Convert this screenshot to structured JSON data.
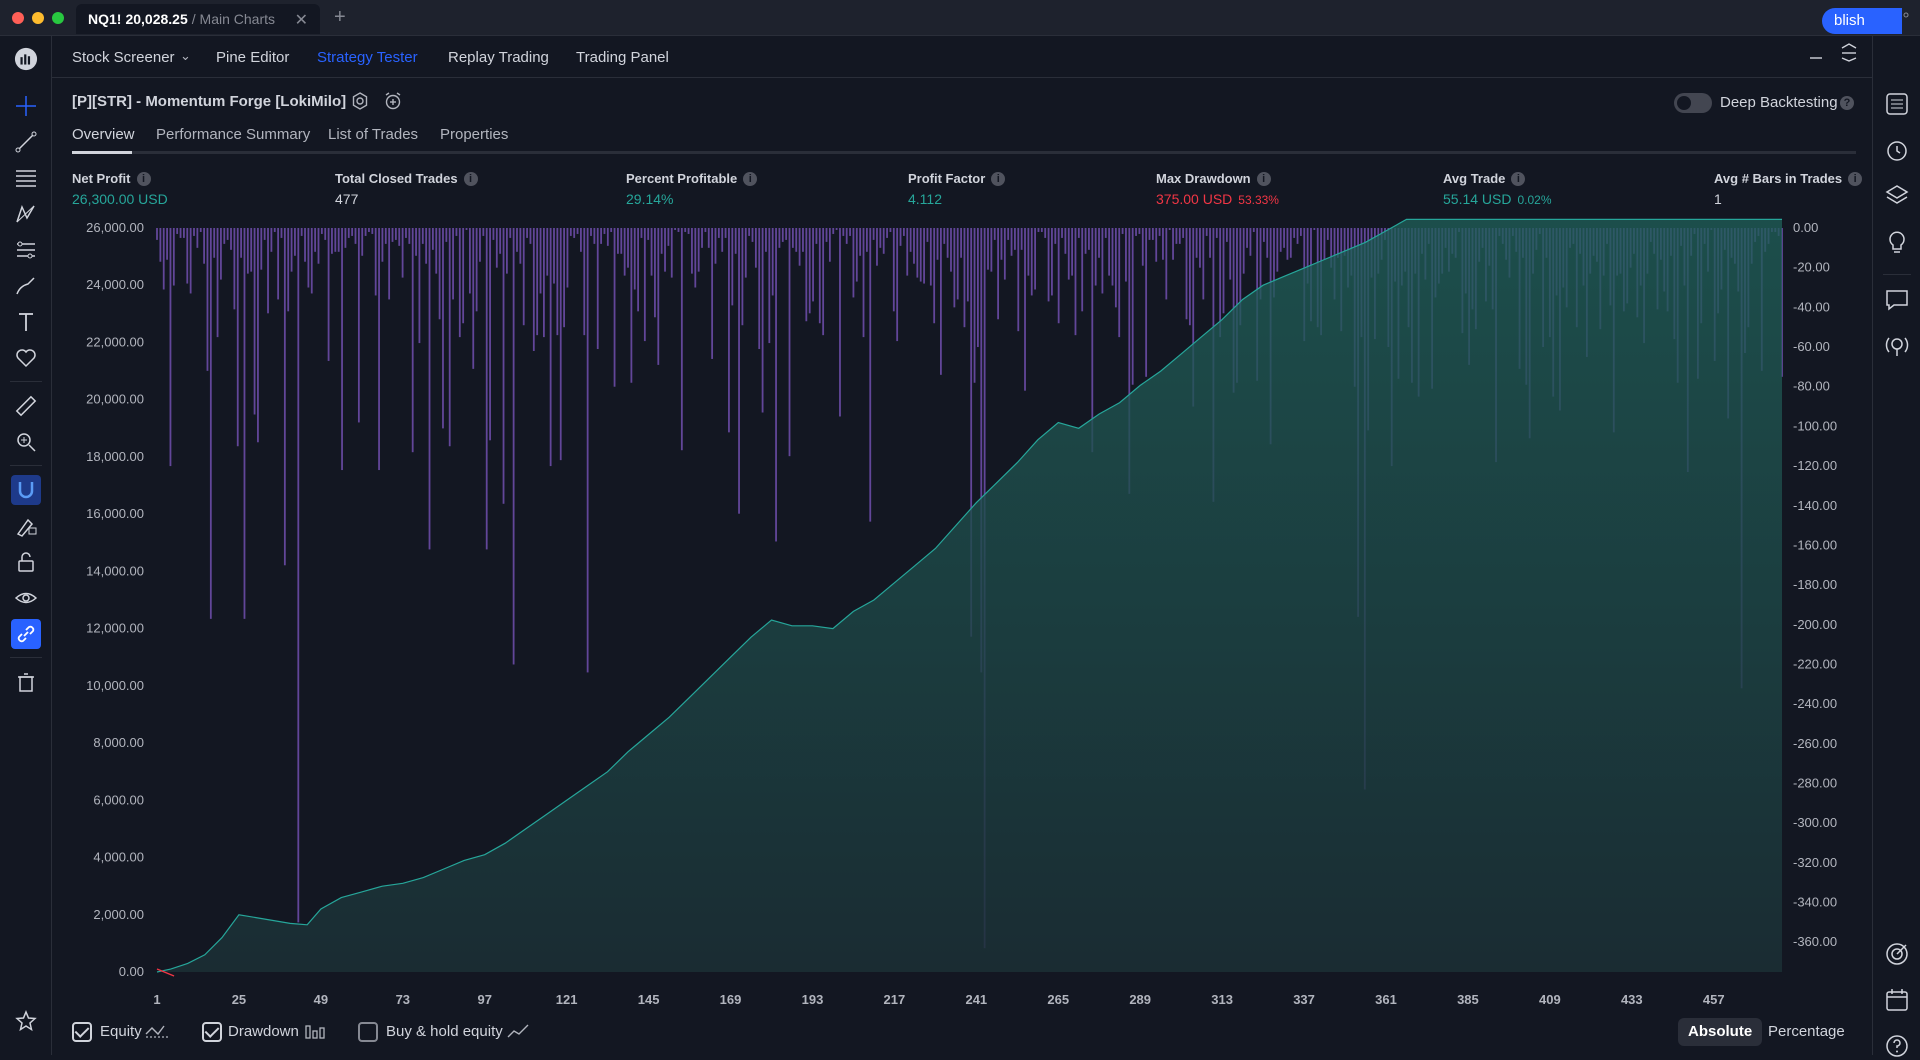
{
  "window": {
    "tab_symbol": "NQ1!",
    "tab_price": "20,028.25",
    "tab_subtitle": "/ Main Charts",
    "tab_close": "✕",
    "new_tab": "+"
  },
  "menu": {
    "items": [
      {
        "label": "Stock Screener",
        "dropdown": true
      },
      {
        "label": "Pine Editor"
      },
      {
        "label": "Strategy Tester",
        "active": true
      },
      {
        "label": "Replay Trading"
      },
      {
        "label": "Trading Panel"
      }
    ],
    "publish_label": "blish"
  },
  "strategy": {
    "title": "[P][STR] - Momentum Forge [LokiMilo]",
    "deep_backtesting_label": "Deep Backtesting",
    "deep_backtesting_on": false
  },
  "subtabs": [
    "Overview",
    "Performance Summary",
    "List of Trades",
    "Properties"
  ],
  "metrics": [
    {
      "label": "Net Profit",
      "value": "26,300.00 USD",
      "pct": "",
      "color": "#26a69a"
    },
    {
      "label": "Total Closed Trades",
      "value": "477",
      "pct": "",
      "color": "#d1d4dc"
    },
    {
      "label": "Percent Profitable",
      "value": "29.14%",
      "pct": "",
      "color": "#26a69a"
    },
    {
      "label": "Profit Factor",
      "value": "4.112",
      "pct": "",
      "color": "#26a69a"
    },
    {
      "label": "Max Drawdown",
      "value": "375.00 USD",
      "pct": "53.33%",
      "color": "#f23645"
    },
    {
      "label": "Avg Trade",
      "value": "55.14 USD",
      "pct": "0.02%",
      "color": "#26a69a"
    },
    {
      "label": "Avg # Bars in Trades",
      "value": "1",
      "pct": "",
      "color": "#d1d4dc"
    }
  ],
  "chart_data": {
    "type": "area",
    "series": [
      {
        "name": "Equity",
        "color": "#26a69a",
        "x": [
          1,
          5,
          10,
          15,
          20,
          25,
          30,
          35,
          40,
          45,
          49,
          55,
          61,
          67,
          73,
          79,
          85,
          91,
          97,
          103,
          109,
          115,
          121,
          127,
          133,
          139,
          145,
          151,
          157,
          163,
          169,
          175,
          181,
          187,
          193,
          199,
          205,
          211,
          217,
          223,
          229,
          235,
          241,
          247,
          253,
          259,
          265,
          271,
          277,
          283,
          289,
          295,
          301,
          307,
          313,
          319,
          325,
          331,
          337,
          343,
          349,
          355,
          361,
          367,
          373,
          379,
          385,
          391,
          397,
          403,
          409,
          415,
          421,
          427,
          433,
          439,
          445,
          451,
          457,
          463,
          469,
          477
        ],
        "y": [
          0,
          100,
          300,
          600,
          1200,
          2000,
          1900,
          1800,
          1700,
          1650,
          2200,
          2600,
          2800,
          3000,
          3100,
          3300,
          3600,
          3900,
          4100,
          4500,
          5000,
          5500,
          6000,
          6500,
          7000,
          7700,
          8300,
          8900,
          9600,
          10300,
          11000,
          11700,
          12300,
          12100,
          12100,
          12000,
          12600,
          13000,
          13600,
          14200,
          14800,
          15600,
          16400,
          17100,
          17800,
          18600,
          19200,
          19000,
          19500,
          19900,
          20500,
          21000,
          21600,
          22200,
          22800,
          23500,
          24000,
          24300,
          24600,
          24900,
          25200,
          25500,
          25900,
          26300,
          26300,
          26300,
          26300,
          26300,
          26300,
          26300,
          26300,
          26300,
          26300,
          26300,
          26300,
          26300,
          26300,
          26300,
          26300,
          26300,
          26300,
          26300
        ]
      },
      {
        "name": "Drawdown",
        "color": "#7e57c2",
        "y": [
          -6,
          -17,
          -31,
          -16,
          -120,
          -29,
          -3,
          -5,
          -5,
          -28,
          -33,
          -4,
          -10,
          -2,
          -18,
          -72,
          -197,
          -15,
          -55,
          -26,
          -8,
          -6,
          -11,
          -41,
          -110,
          -15,
          -197,
          -23,
          -22,
          -94,
          -108,
          -21,
          -6,
          -43,
          -12,
          -2,
          -36,
          -5,
          -170,
          -42,
          -22,
          -14,
          -350,
          -4,
          -17,
          -30,
          -33,
          -12,
          -18,
          -3,
          -6,
          -67,
          -13,
          -12,
          -12,
          -122,
          -10,
          -5,
          -4,
          -8,
          -98,
          -14,
          -4,
          -2,
          -3,
          -34,
          -122,
          -17,
          -8,
          -36,
          -7,
          -6,
          -9,
          -25,
          -5,
          -8,
          -113,
          -14,
          -58,
          -8,
          -18,
          -162,
          -11,
          -23,
          -46,
          -101,
          -7,
          -110,
          -36,
          -4,
          -55,
          -48,
          -1,
          -33,
          -71,
          -42,
          -17,
          -4,
          -162,
          -107,
          -6,
          -20,
          -13,
          -139,
          -23,
          -5,
          -220,
          -12,
          -18,
          -49,
          -5,
          -8,
          -62,
          -54,
          -33,
          -55,
          -24,
          -120,
          -28,
          -54,
          -117,
          -50,
          -30,
          -4,
          -5,
          -3,
          -12,
          -54,
          -224,
          -4,
          -8,
          -61,
          -8,
          -3,
          -9,
          -2,
          -80,
          -13,
          -13,
          -24,
          -20,
          -78,
          -31,
          -42,
          -5,
          -57,
          -6,
          -24,
          -45,
          -69,
          -13,
          -22,
          -9,
          -25,
          -1,
          -2,
          -112,
          -2,
          -3,
          -23,
          -30,
          -22,
          -10,
          -2,
          -10,
          -66,
          -18,
          -5,
          -12,
          -5,
          -103,
          -39,
          -13,
          -144,
          -49,
          -25,
          -4,
          -7,
          -20,
          -61,
          -93,
          -12,
          -58,
          -34,
          -158,
          -10,
          -7,
          -6,
          -115,
          -10,
          -12,
          -19,
          -12,
          -47,
          -43,
          -37,
          -8,
          -48,
          -54,
          -7,
          -17,
          -3,
          -1,
          -95,
          -4,
          -8,
          -4,
          -35,
          -27,
          -14,
          -55,
          -12,
          -148,
          -6,
          -19,
          -10,
          -13,
          -5,
          -2,
          -42,
          -57,
          -9,
          -4,
          -24,
          -12,
          -18,
          -25,
          -27,
          -28,
          -7,
          -29,
          -48,
          -16,
          -74,
          -8,
          -15,
          -22,
          -40,
          -36,
          -15,
          -50,
          -37,
          -206,
          -78,
          -60,
          -224,
          -363,
          -21,
          -22,
          -6,
          -46,
          -16,
          -26,
          -6,
          -14,
          -11,
          -52,
          -11,
          -82,
          -24,
          -34,
          -31,
          -2,
          -2,
          -5,
          -37,
          -34,
          -8,
          -48,
          -5,
          -13,
          -26,
          -24,
          -54,
          -5,
          -42,
          -13,
          -11,
          -113,
          -29,
          -15,
          -33,
          -5,
          -24,
          -29,
          -40,
          -55,
          -3,
          -27,
          -134,
          -79,
          -4,
          -3,
          -19,
          -75,
          -6,
          -6,
          -17,
          -4,
          -16,
          -36,
          -1,
          -16,
          -8,
          -8,
          -5,
          -46,
          -49,
          -90,
          -15,
          -20,
          -36,
          -4,
          -15,
          -138,
          -5,
          -55,
          -43,
          -7,
          -26,
          -83,
          -78,
          -49,
          -23,
          -10,
          -14,
          -2,
          -77,
          -36,
          -7,
          -15,
          -109,
          -35,
          -22,
          -12,
          -10,
          -16,
          -15,
          -5,
          -8,
          -4,
          -57,
          -28,
          -47,
          -1,
          -50,
          -54,
          -16,
          -6,
          -20,
          -36,
          -15,
          -52,
          -14,
          -30,
          -24,
          -80,
          -196,
          -55,
          -283,
          -102,
          -25,
          -56,
          -23,
          -16,
          -6,
          -60,
          -120,
          -27,
          -76,
          -29,
          -22,
          -50,
          -78,
          -23,
          -85,
          -13,
          -26,
          -8,
          -81,
          -35,
          -28,
          -23,
          -10,
          -22,
          -13,
          -15,
          -2,
          -53,
          -33,
          -69,
          -41,
          -51,
          -17,
          -10,
          -37,
          -19,
          -41,
          -118,
          -4,
          -8,
          -16,
          -25,
          -4,
          -12,
          -71,
          -15,
          -79,
          -106,
          -23,
          -11,
          -3,
          -60,
          -15,
          -55,
          -85,
          -34,
          -92,
          -30,
          -40,
          -10,
          -8,
          -50,
          -13,
          -29,
          -65,
          -23,
          -14,
          -17,
          -51,
          -24,
          -8,
          -39,
          -103,
          -24,
          -23,
          -42,
          -38,
          -20,
          -13,
          -45,
          -29,
          -58,
          -23,
          -7,
          -13,
          -41,
          -16,
          -32,
          -42,
          -14,
          -56,
          -78,
          -9,
          -29,
          -123,
          -14,
          -3,
          -76,
          -48,
          -8,
          -22,
          -1,
          -67,
          -43,
          -31,
          -11,
          -96,
          -15,
          -18,
          -32,
          -232,
          -63,
          -50,
          -18,
          -7,
          -4,
          -72,
          -12,
          -8,
          -2,
          -2,
          -4,
          -75
        ]
      }
    ],
    "x_ticks": [
      "1",
      "25",
      "49",
      "73",
      "97",
      "121",
      "145",
      "169",
      "193",
      "217",
      "241",
      "265",
      "289",
      "313",
      "337",
      "361",
      "385",
      "409",
      "433",
      "457"
    ],
    "y_left_ticks": [
      "26,000.00",
      "24,000.00",
      "22,000.00",
      "20,000.00",
      "18,000.00",
      "16,000.00",
      "14,000.00",
      "12,000.00",
      "10,000.00",
      "8,000.00",
      "6,000.00",
      "4,000.00",
      "2,000.00",
      "0.00"
    ],
    "y_right_ticks": [
      "0.00",
      "-20.00",
      "-40.00",
      "-60.00",
      "-80.00",
      "-100.00",
      "-120.00",
      "-140.00",
      "-160.00",
      "-180.00",
      "-200.00",
      "-220.00",
      "-240.00",
      "-260.00",
      "-280.00",
      "-300.00",
      "-320.00",
      "-340.00",
      "-360.00"
    ],
    "xlim": [
      1,
      477
    ],
    "ylim_left": [
      0,
      26000
    ],
    "ylim_right": [
      -375,
      0
    ]
  },
  "bottom": {
    "equity": {
      "label": "Equity",
      "checked": true
    },
    "drawdown": {
      "label": "Drawdown",
      "checked": true
    },
    "buyhold": {
      "label": "Buy & hold equity",
      "checked": false
    },
    "absolute": "Absolute",
    "percentage": "Percentage"
  }
}
